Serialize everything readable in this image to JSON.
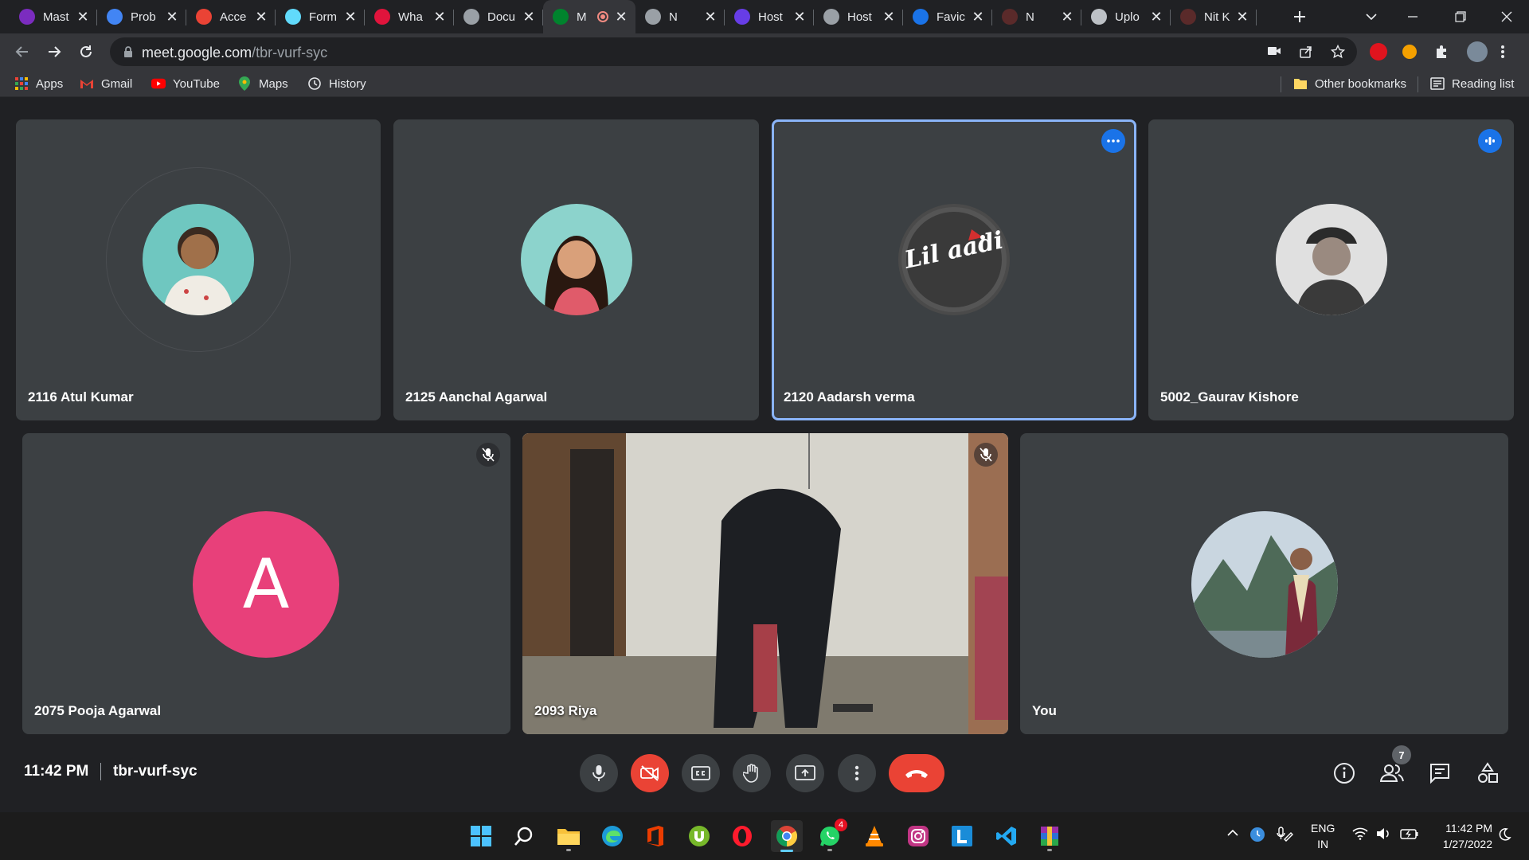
{
  "browser": {
    "tabs": [
      {
        "title": "Mast",
        "icon": "shield-u-icon",
        "color": "#7b2cbf"
      },
      {
        "title": "Prob",
        "icon": "bar-chart-icon",
        "color": "#4285f4"
      },
      {
        "title": "Acce",
        "icon": "gmail-icon",
        "color": "#ea4335"
      },
      {
        "title": "Form",
        "icon": "react-icon",
        "color": "#61dafb"
      },
      {
        "title": "Wha",
        "icon": "d-logo-icon",
        "color": "#e0143c"
      },
      {
        "title": "Docu",
        "icon": "globe-icon",
        "color": "#9aa0a6"
      },
      {
        "title": "M",
        "icon": "meet-icon",
        "color": "#00832d",
        "active": true,
        "recording": true
      },
      {
        "title": "N",
        "icon": "globe-icon",
        "color": "#9aa0a6"
      },
      {
        "title": "Host",
        "icon": "h-logo-icon",
        "color": "#673de6"
      },
      {
        "title": "Host",
        "icon": "globe-icon",
        "color": "#9aa0a6"
      },
      {
        "title": "Favic",
        "icon": "f-logo-icon",
        "color": "#1a73e8"
      },
      {
        "title": "N",
        "icon": "anime-icon",
        "color": "#5a2a2a"
      },
      {
        "title": "Uplo",
        "icon": "layers-icon",
        "color": "#bdc1c6"
      },
      {
        "title": "Nit K",
        "icon": "anime-icon",
        "color": "#5a2a2a"
      }
    ],
    "url_host": "meet.google.com",
    "url_path": "/tbr-vurf-syc",
    "bookmarks": [
      {
        "label": "Apps",
        "icon": "apps-grid-icon"
      },
      {
        "label": "Gmail",
        "icon": "gmail-icon"
      },
      {
        "label": "YouTube",
        "icon": "youtube-icon"
      },
      {
        "label": "Maps",
        "icon": "maps-pin-icon"
      },
      {
        "label": "History",
        "icon": "history-icon"
      }
    ],
    "other_bookmarks": "Other bookmarks",
    "reading_list": "Reading list"
  },
  "meet": {
    "participants": [
      {
        "name": "2116 Atul Kumar",
        "avatar_color": "#6fc7c0"
      },
      {
        "name": "2125 Aanchal Agarwal",
        "avatar_color": "#8cd3cc"
      },
      {
        "name": "2120 Aadarsh verma",
        "avatar_color": "#4a4a4a",
        "speaking": true,
        "avatar_text": "Lil aadi"
      },
      {
        "name": "5002_Gaurav Kishore",
        "avatar_color": "#bdbdbd"
      },
      {
        "name": "2075 Pooja Agarwal",
        "avatar_color": "#e8407a",
        "initial": "A",
        "muted": true
      },
      {
        "name": "2093 Riya",
        "video": true,
        "muted": true
      },
      {
        "name": "You",
        "avatar_color": "#8fa3b8"
      }
    ],
    "time": "11:42 PM",
    "meeting_code": "tbr-vurf-syc",
    "participant_count": "7",
    "accent": "#8ab4f8",
    "danger": "#ea4335"
  },
  "taskbar": {
    "apps": [
      "windows-start-icon",
      "search-icon",
      "file-explorer-icon",
      "edge-icon",
      "office-icon",
      "utorrent-icon",
      "opera-icon",
      "chrome-icon",
      "whatsapp-icon",
      "vlc-icon",
      "instagram-icon",
      "l-app-icon",
      "vscode-icon",
      "winrar-icon"
    ],
    "whatsapp_badge": "4",
    "lang_top": "ENG",
    "lang_bottom": "IN",
    "time": "11:42 PM",
    "date": "1/27/2022"
  }
}
